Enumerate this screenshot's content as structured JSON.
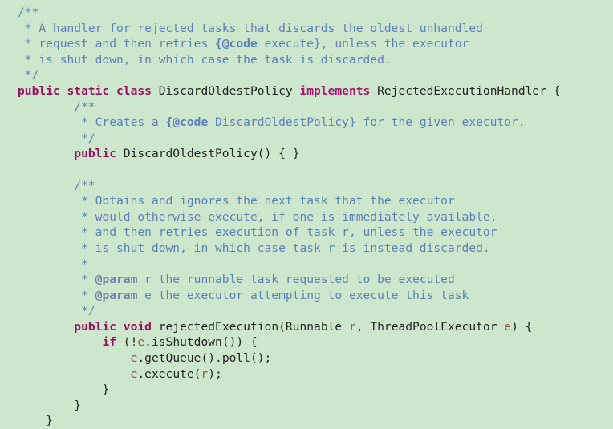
{
  "viewer": {
    "name": "java-source-code-view",
    "language": "Java",
    "background_color": "#cde7cd",
    "comment_color": "#5d7fba",
    "keyword_color": "#9c0d62",
    "plain_color": "#232323",
    "parameter_color": "#94564a"
  },
  "code": {
    "lines": [
      {
        "n": 1,
        "indent": 1,
        "tokens": [
          {
            "t": "comment",
            "v": "/**"
          }
        ]
      },
      {
        "n": 2,
        "indent": 1,
        "tokens": [
          {
            "t": "comment",
            "v": " * A handler for rejected tasks that discards the oldest unhandled"
          }
        ]
      },
      {
        "n": 3,
        "indent": 1,
        "tokens": [
          {
            "t": "comment",
            "v": " * request and then retries "
          },
          {
            "t": "comment-tag",
            "v": "{@code"
          },
          {
            "t": "comment",
            "v": " execute}, unless the executor"
          }
        ]
      },
      {
        "n": 4,
        "indent": 1,
        "tokens": [
          {
            "t": "comment",
            "v": " * is shut down, in which case the task is discarded."
          }
        ]
      },
      {
        "n": 5,
        "indent": 1,
        "tokens": [
          {
            "t": "comment",
            "v": " */"
          }
        ]
      },
      {
        "n": 6,
        "indent": 0,
        "tokens": [
          {
            "t": "keyword",
            "v": "public static class"
          },
          {
            "t": "plain",
            "v": " DiscardOldestPolicy "
          },
          {
            "t": "keyword2",
            "v": "implements"
          },
          {
            "t": "plain",
            "v": " RejectedExecutionHandler {"
          }
        ]
      },
      {
        "n": 7,
        "indent": 0,
        "tokens": [
          {
            "t": "comment",
            "v": "        /**"
          }
        ]
      },
      {
        "n": 8,
        "indent": 0,
        "tokens": [
          {
            "t": "comment",
            "v": "         * Creates a "
          },
          {
            "t": "comment-tag",
            "v": "{@code"
          },
          {
            "t": "comment",
            "v": " DiscardOldestPolicy} for the given executor."
          }
        ]
      },
      {
        "n": 9,
        "indent": 0,
        "tokens": [
          {
            "t": "comment",
            "v": "         */"
          }
        ]
      },
      {
        "n": 10,
        "indent": 0,
        "tokens": [
          {
            "t": "plain",
            "v": "        "
          },
          {
            "t": "keyword",
            "v": "public"
          },
          {
            "t": "plain",
            "v": " DiscardOldestPolicy() { }"
          }
        ]
      },
      {
        "n": 11,
        "indent": 0,
        "tokens": [
          {
            "t": "plain",
            "v": ""
          }
        ]
      },
      {
        "n": 12,
        "indent": 0,
        "tokens": [
          {
            "t": "comment",
            "v": "        /**"
          }
        ]
      },
      {
        "n": 13,
        "indent": 0,
        "tokens": [
          {
            "t": "comment",
            "v": "         * Obtains and ignores the next task that the executor"
          }
        ]
      },
      {
        "n": 14,
        "indent": 0,
        "tokens": [
          {
            "t": "comment",
            "v": "         * would otherwise execute, if one is immediately available,"
          }
        ]
      },
      {
        "n": 15,
        "indent": 0,
        "tokens": [
          {
            "t": "comment",
            "v": "         * and then retries execution of task r, unless the executor"
          }
        ]
      },
      {
        "n": 16,
        "indent": 0,
        "tokens": [
          {
            "t": "comment",
            "v": "         * is shut down, in which case task r is instead discarded."
          }
        ]
      },
      {
        "n": 17,
        "indent": 0,
        "tokens": [
          {
            "t": "comment",
            "v": "         *"
          }
        ]
      },
      {
        "n": 18,
        "indent": 0,
        "tokens": [
          {
            "t": "comment",
            "v": "         * "
          },
          {
            "t": "javadoc-tag",
            "v": "@param"
          },
          {
            "t": "comment",
            "v": " r the runnable task requested to be executed"
          }
        ]
      },
      {
        "n": 19,
        "indent": 0,
        "tokens": [
          {
            "t": "comment",
            "v": "         * "
          },
          {
            "t": "javadoc-tag",
            "v": "@param"
          },
          {
            "t": "comment",
            "v": " e the executor attempting to execute this task"
          }
        ]
      },
      {
        "n": 20,
        "indent": 0,
        "tokens": [
          {
            "t": "comment",
            "v": "         */"
          }
        ]
      },
      {
        "n": 21,
        "indent": 0,
        "tokens": [
          {
            "t": "plain",
            "v": "        "
          },
          {
            "t": "keyword",
            "v": "public void"
          },
          {
            "t": "plain",
            "v": " rejectedExecution(Runnable "
          },
          {
            "t": "param",
            "v": "r"
          },
          {
            "t": "plain",
            "v": ", ThreadPoolExecutor "
          },
          {
            "t": "param",
            "v": "e"
          },
          {
            "t": "plain",
            "v": ") {"
          }
        ]
      },
      {
        "n": 22,
        "indent": 0,
        "tokens": [
          {
            "t": "plain",
            "v": "            "
          },
          {
            "t": "keyword",
            "v": "if"
          },
          {
            "t": "plain",
            "v": " (!"
          },
          {
            "t": "param",
            "v": "e"
          },
          {
            "t": "plain",
            "v": ".isShutdown()) {"
          }
        ]
      },
      {
        "n": 23,
        "indent": 0,
        "tokens": [
          {
            "t": "plain",
            "v": "                "
          },
          {
            "t": "param",
            "v": "e"
          },
          {
            "t": "plain",
            "v": ".getQueue().poll();"
          }
        ]
      },
      {
        "n": 24,
        "indent": 0,
        "tokens": [
          {
            "t": "plain",
            "v": "                "
          },
          {
            "t": "param",
            "v": "e"
          },
          {
            "t": "plain",
            "v": ".execute("
          },
          {
            "t": "param",
            "v": "r"
          },
          {
            "t": "plain",
            "v": ");"
          }
        ]
      },
      {
        "n": 25,
        "indent": 0,
        "tokens": [
          {
            "t": "plain",
            "v": "            }"
          }
        ]
      },
      {
        "n": 26,
        "indent": 0,
        "tokens": [
          {
            "t": "plain",
            "v": "        }"
          }
        ]
      },
      {
        "n": 27,
        "indent": 0,
        "tokens": [
          {
            "t": "plain",
            "v": "    }"
          }
        ]
      }
    ]
  }
}
